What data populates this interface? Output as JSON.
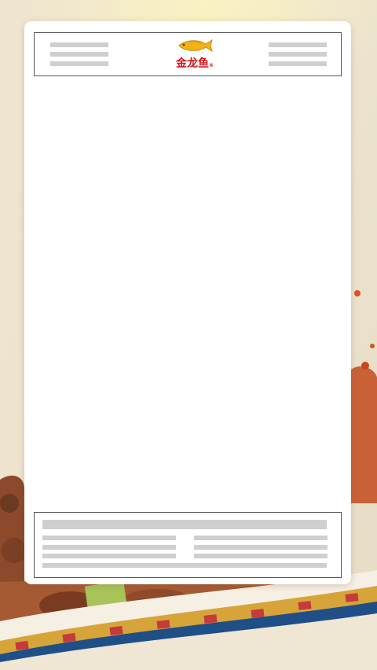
{
  "brand": {
    "name": "金龙鱼",
    "registered_mark": "®",
    "logo_icon": "golden-arowana-fish-icon",
    "colors": {
      "text": "#d0121b",
      "fish": "#f2b21a"
    }
  },
  "placeholders": {
    "header_left_lines": 3,
    "header_right_lines": 3,
    "footer_lines": 6
  }
}
